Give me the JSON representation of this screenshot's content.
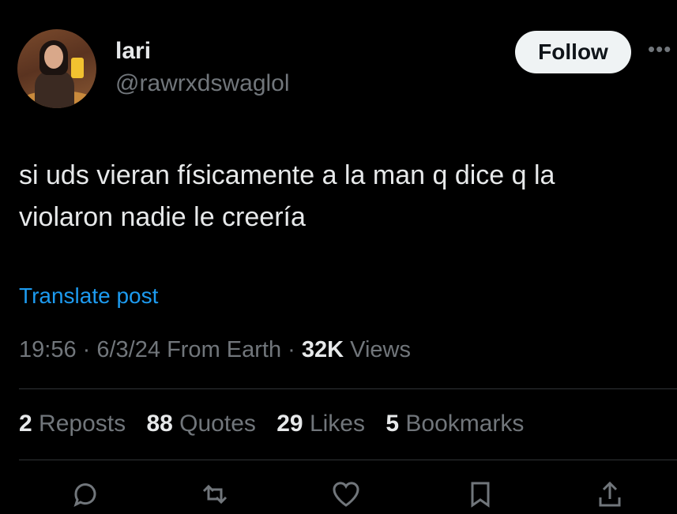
{
  "user": {
    "name": "lari",
    "handle": "@rawrxdswaglol"
  },
  "follow_label": "Follow",
  "more_icon": "more-horizontal-icon",
  "post": {
    "text": "si uds vieran físicamente a la man q dice q la violaron nadie le creería",
    "translate_label": "Translate post"
  },
  "meta": {
    "time": "19:56",
    "date": "6/3/24",
    "source": "From Earth",
    "views_count": "32K",
    "views_label": "Views"
  },
  "stats": {
    "reposts_count": "2",
    "reposts_label": "Reposts",
    "quotes_count": "88",
    "quotes_label": "Quotes",
    "likes_count": "29",
    "likes_label": "Likes",
    "bookmarks_count": "5",
    "bookmarks_label": "Bookmarks"
  },
  "colors": {
    "background": "#000000",
    "text": "#e7e9ea",
    "secondary": "#71767b",
    "link": "#1d9bf0",
    "divider": "#2f3336"
  },
  "action_icons": [
    "reply-icon",
    "repost-icon",
    "like-icon",
    "bookmark-icon",
    "share-icon"
  ]
}
